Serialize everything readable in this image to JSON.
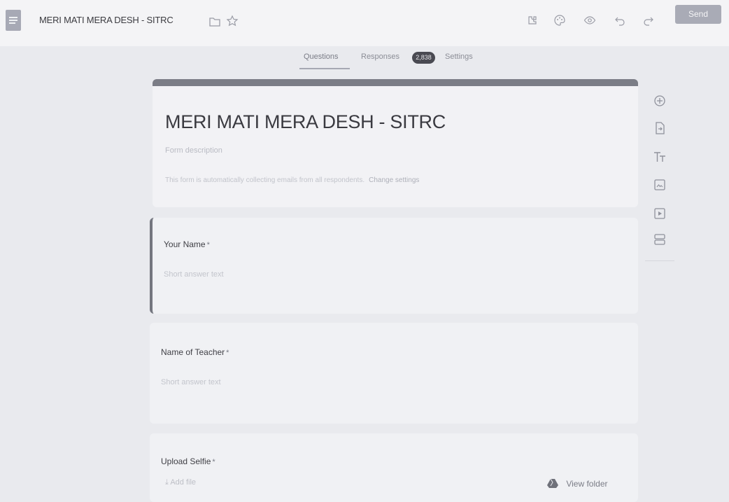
{
  "header": {
    "form_title": "MERI MATI MERA DESH - SITRC",
    "send_label": "Send",
    "icons": [
      "docs-icon",
      "folder-icon",
      "star-icon",
      "addon-icon",
      "palette-icon",
      "preview-icon",
      "undo-icon",
      "redo-icon"
    ]
  },
  "tabs": {
    "questions": "Questions",
    "responses": "Responses",
    "responses_count": "2,838",
    "settings": "Settings"
  },
  "form": {
    "heading": "MERI MATI MERA DESH - SITRC",
    "description_placeholder": "Form description",
    "email_note": "This form is automatically collecting emails from all respondents.",
    "change_settings": "Change settings"
  },
  "questions": [
    {
      "title": "Your Name",
      "required_mark": "*",
      "hint": "Short answer text"
    },
    {
      "title": "Name of Teacher",
      "required_mark": "*",
      "hint": "Short answer text"
    },
    {
      "title": "Upload Selfie",
      "required_mark": "*",
      "add_file": "Add file",
      "view_folder": "View folder"
    }
  ],
  "toolbar": {
    "items": [
      "add-question-icon",
      "import-questions-icon",
      "add-title-icon",
      "add-image-icon",
      "add-video-icon",
      "add-section-icon"
    ]
  },
  "colors": {
    "accent": "#74767f",
    "send_button": "#a9abb6"
  }
}
